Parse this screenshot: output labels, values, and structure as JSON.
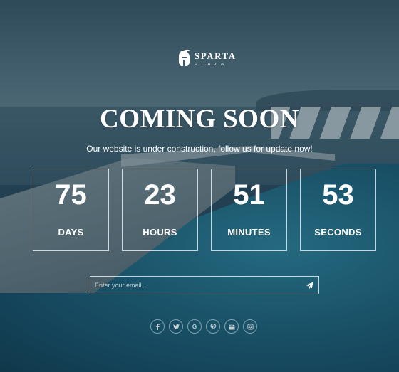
{
  "logo": {
    "name": "SPARTA",
    "sub": "PLAZA",
    "icon": "spartan-helmet-icon"
  },
  "hero": {
    "title": "COMING SOON",
    "subtitle": "Our website is under construction, follow us for update now!"
  },
  "countdown": [
    {
      "value": "75",
      "label": "DAYS"
    },
    {
      "value": "23",
      "label": "HOURS"
    },
    {
      "value": "51",
      "label": "MINUTES"
    },
    {
      "value": "53",
      "label": "SECONDS"
    }
  ],
  "subscribe": {
    "placeholder": "Enter your email...",
    "value": "",
    "button_icon": "paper-plane-icon"
  },
  "social": [
    {
      "name": "facebook-icon",
      "glyph": "f"
    },
    {
      "name": "twitter-icon",
      "glyph": ""
    },
    {
      "name": "google-icon",
      "glyph": "G"
    },
    {
      "name": "pinterest-icon",
      "glyph": ""
    },
    {
      "name": "youtube-icon",
      "glyph": ""
    },
    {
      "name": "instagram-icon",
      "glyph": ""
    }
  ],
  "colors": {
    "text": "#ffffff",
    "overlay": "#142d3c"
  }
}
